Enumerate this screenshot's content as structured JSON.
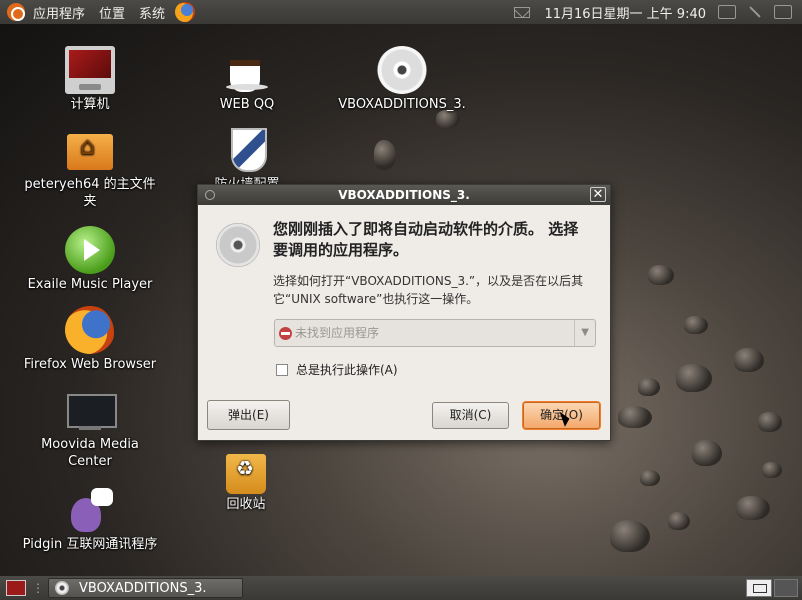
{
  "top_panel": {
    "menus": [
      "应用程序",
      "位置",
      "系统"
    ],
    "clock": "11月16日星期一 上午 9:40"
  },
  "desktop_icons": [
    {
      "name": "computer-desktop-icon",
      "glyph": "monitor",
      "label": "计算机"
    },
    {
      "name": "home-folder-desktop-icon",
      "glyph": "folder",
      "label": "peteryeh64 的主文件夹"
    },
    {
      "name": "exaile-desktop-icon",
      "glyph": "play",
      "label": "Exaile Music Player"
    },
    {
      "name": "firefox-desktop-icon",
      "glyph": "firefox",
      "label": "Firefox Web Browser"
    },
    {
      "name": "moovida-desktop-icon",
      "glyph": "moovida",
      "label": "Moovida Media Center"
    },
    {
      "name": "pidgin-desktop-icon",
      "glyph": "pidgin",
      "label": "Pidgin 互联网通讯程序"
    },
    {
      "name": "webqq-desktop-icon",
      "glyph": "cup",
      "label": "WEB QQ"
    },
    {
      "name": "firewall-desktop-icon",
      "glyph": "shield",
      "label": "防火墙配置"
    },
    {
      "name": "trash-desktop-icon",
      "glyph": "trash",
      "label": "回收站"
    },
    {
      "name": "vboxadditions-desktop-icon",
      "glyph": "cd",
      "label": "VBOXADDITIONS_3."
    }
  ],
  "dialog": {
    "title": "VBOXADDITIONS_3.",
    "close": "✕",
    "heading": "您刚刚插入了即将自动启动软件的介质。 选择要调用的应用程序。",
    "description": "选择如何打开“VBOXADDITIONS_3.”，以及是否在以后其它“UNIX software”也执行这一操作。",
    "combo_value": "未找到应用程序",
    "combo_arrow": "▼",
    "checkbox_label": "总是执行此操作(A)",
    "eject_label": "弹出(E)",
    "cancel_label": "取消(C)",
    "ok_label": "确定(O)"
  },
  "bottom_panel": {
    "task_label": "VBOXADDITIONS_3."
  }
}
